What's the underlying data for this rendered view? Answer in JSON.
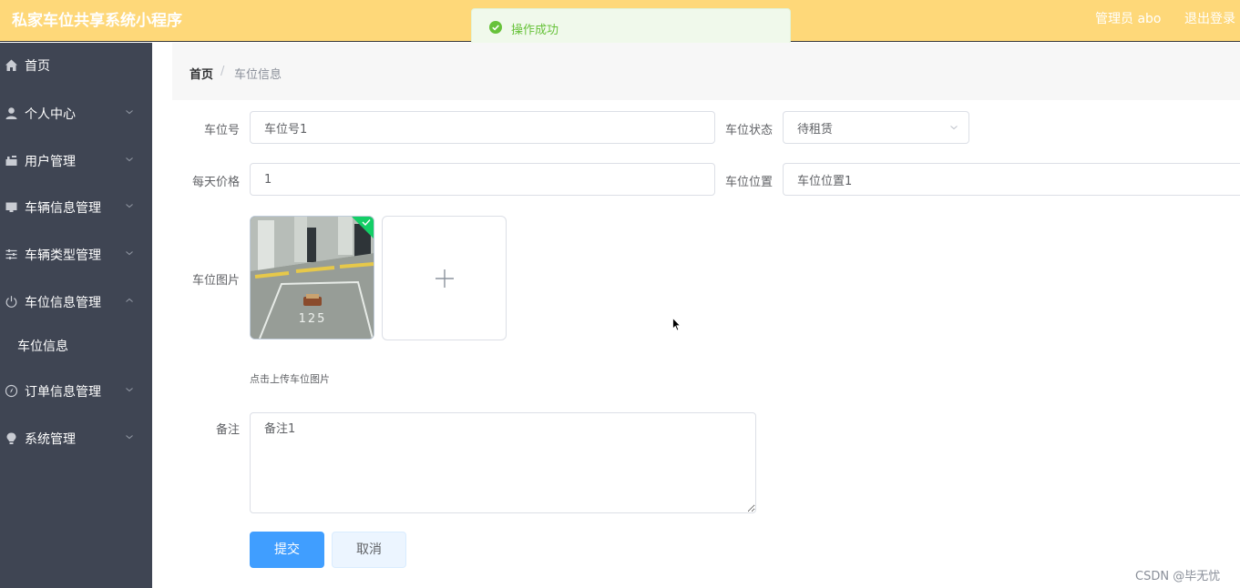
{
  "header": {
    "app_title": "私家车位共享系统小程序",
    "admin_label": "管理员 abo",
    "logout": "退出登录",
    "background": "#fed879"
  },
  "toast": {
    "message": "操作成功",
    "icon": "check-circle-icon",
    "color": "#67c23a"
  },
  "sidebar": {
    "background": "#3f4553",
    "items": [
      {
        "label": "首页",
        "icon": "home-icon"
      },
      {
        "label": "个人中心",
        "icon": "user-icon"
      },
      {
        "label": "用户管理",
        "icon": "users-icon"
      },
      {
        "label": "车辆信息管理",
        "icon": "monitor-icon"
      },
      {
        "label": "车辆类型管理",
        "icon": "sliders-icon"
      },
      {
        "label": "车位信息管理",
        "icon": "power-icon",
        "expanded": true,
        "children": [
          "车位信息"
        ]
      },
      {
        "label": "订单信息管理",
        "icon": "compass-icon"
      },
      {
        "label": "系统管理",
        "icon": "bulb-icon"
      }
    ]
  },
  "breadcrumb": {
    "home": "首页",
    "separator": "/",
    "current": "车位信息"
  },
  "form": {
    "spot_number": {
      "label": "车位号",
      "value": "车位号1"
    },
    "spot_status": {
      "label": "车位状态",
      "value": "待租赁"
    },
    "daily_price": {
      "label": "每天价格",
      "value": "1"
    },
    "spot_location": {
      "label": "车位位置",
      "value": "车位位置1"
    },
    "spot_image": {
      "label": "车位图片",
      "tip": "点击上传车位图片",
      "image_text": "125"
    },
    "remark": {
      "label": "备注",
      "value": "备注1"
    },
    "submit": "提交",
    "cancel": "取消"
  },
  "watermark": "CSDN @毕无忧"
}
